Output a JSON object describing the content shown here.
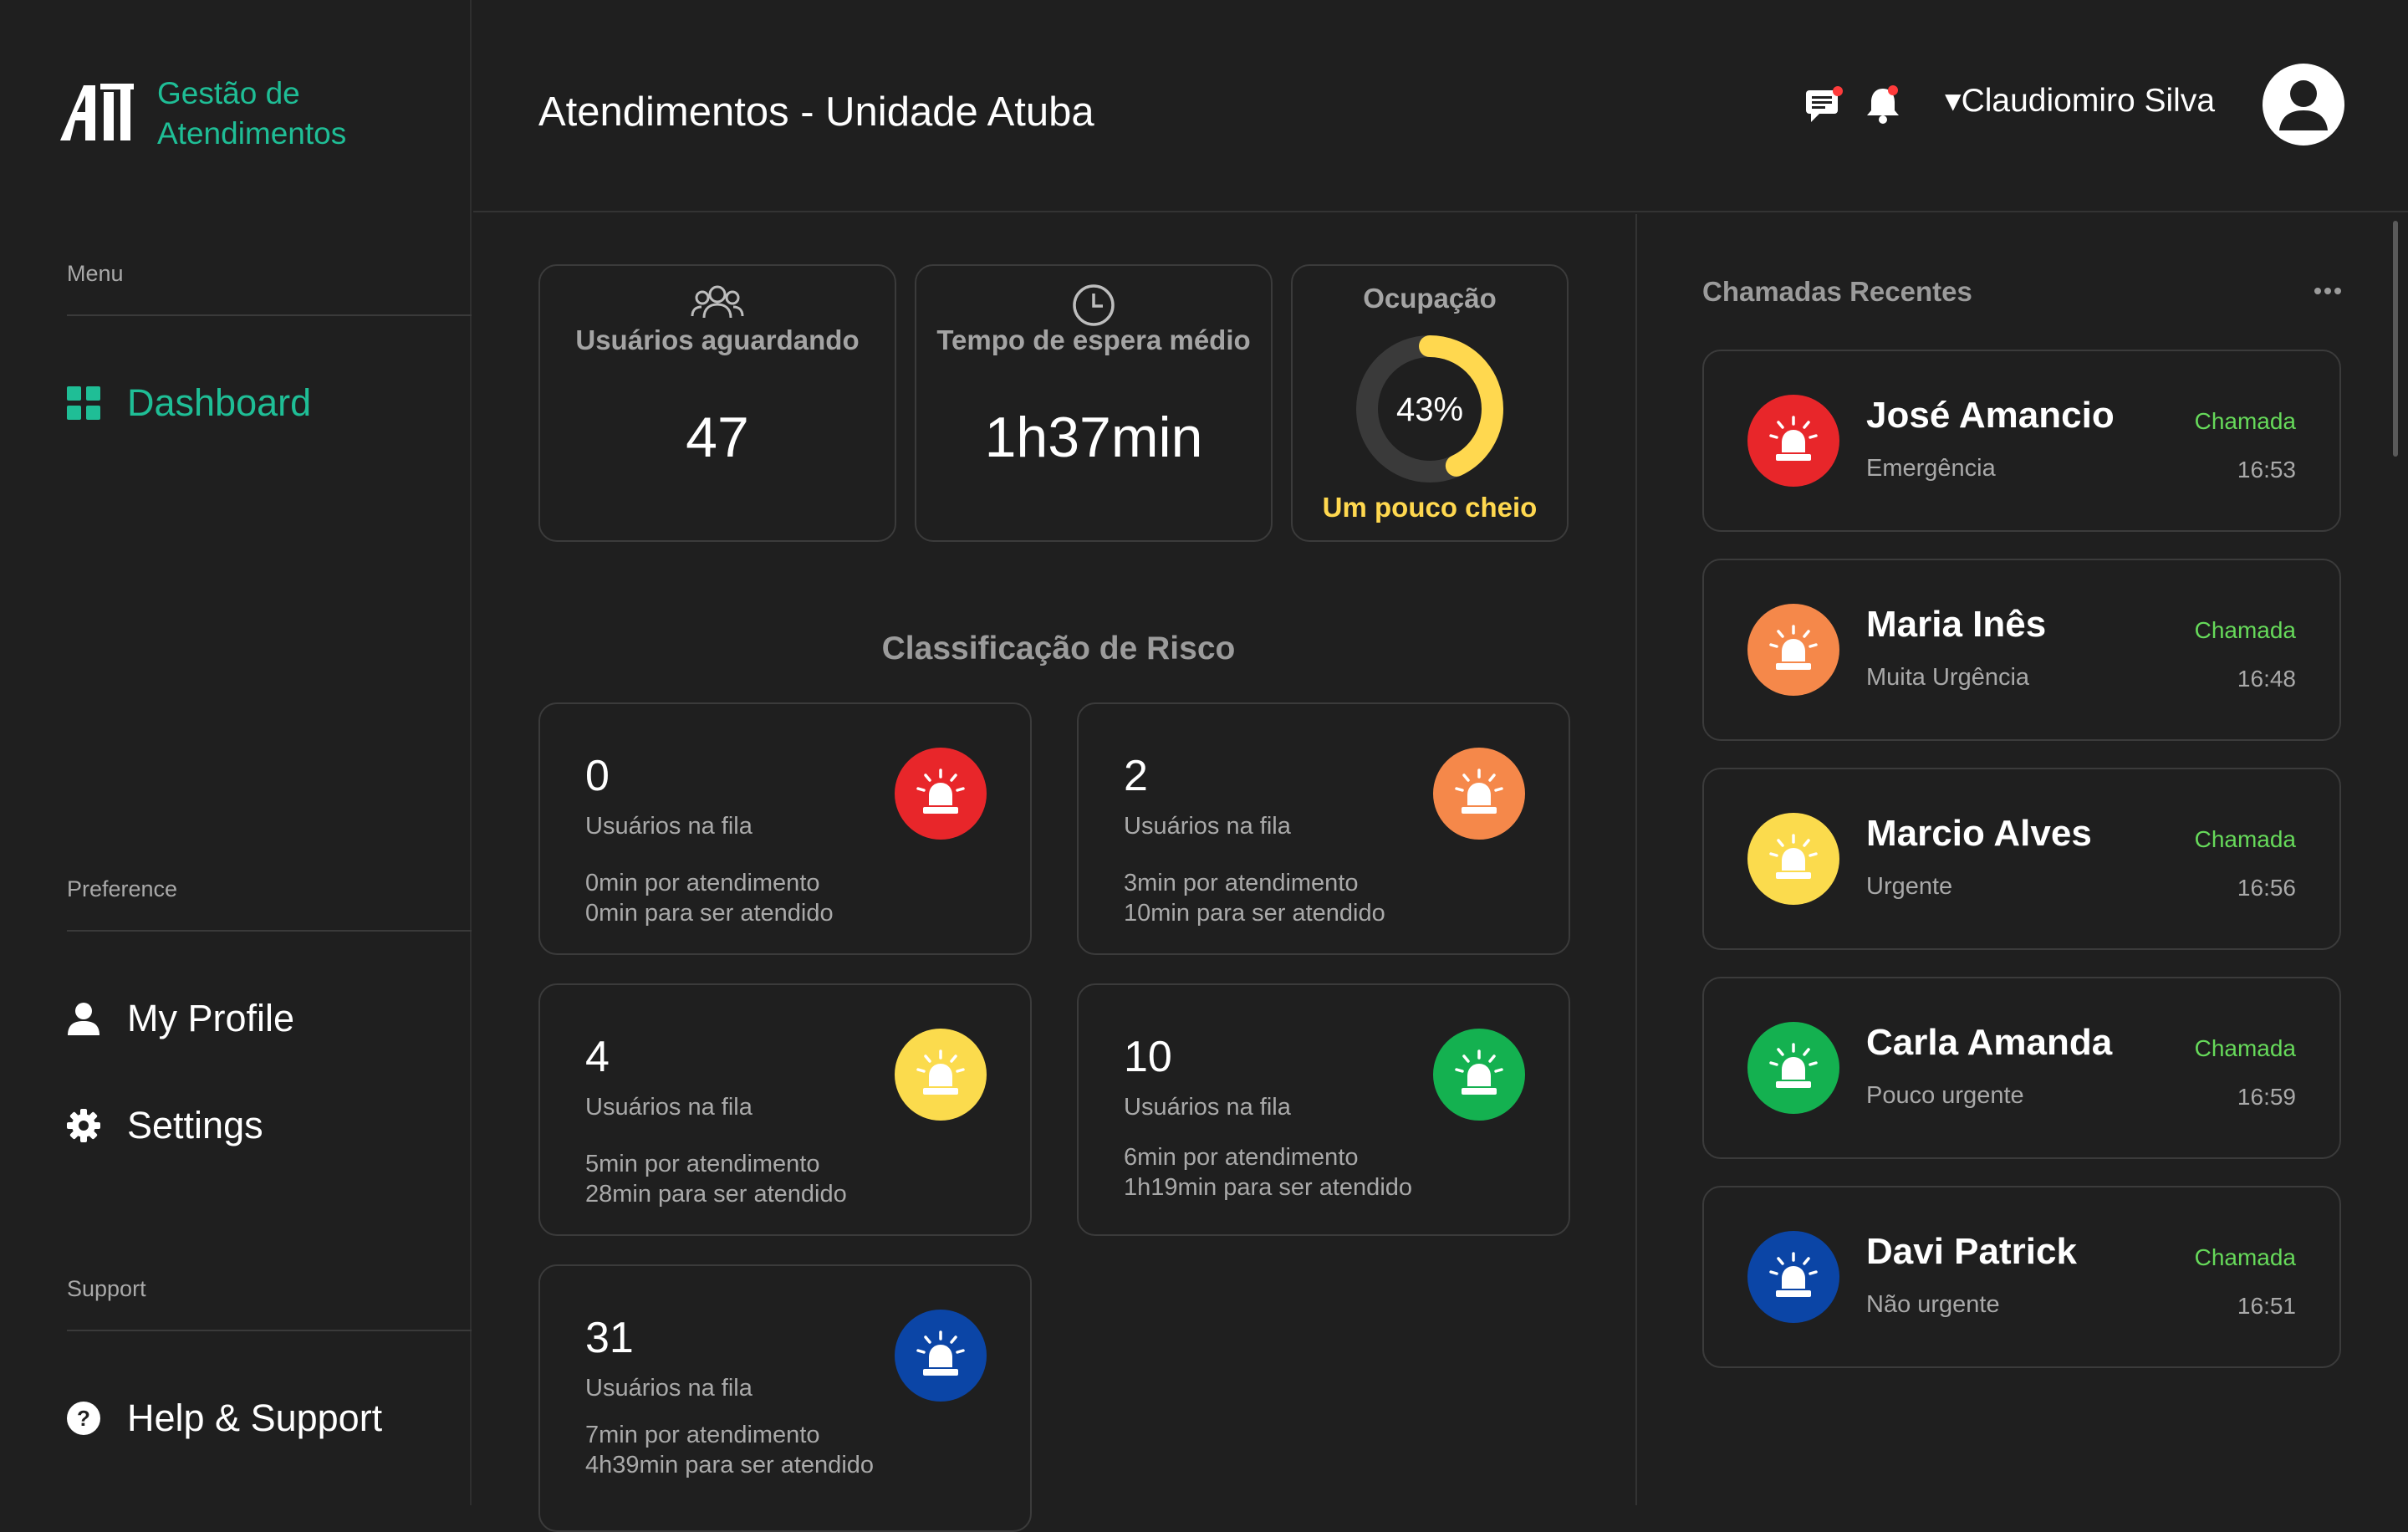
{
  "app": {
    "name": "Gestão de Atendimentos"
  },
  "sidebar": {
    "menu_label": "Menu",
    "items": [
      {
        "label": "Dashboard",
        "icon": "grid-icon",
        "active": true
      }
    ],
    "preference_label": "Preference",
    "preference_items": [
      {
        "label": "My Profile",
        "icon": "user-icon"
      },
      {
        "label": "Settings",
        "icon": "gear-icon"
      }
    ],
    "support_label": "Support",
    "support_items": [
      {
        "label": "Help & Support",
        "icon": "help-icon"
      }
    ]
  },
  "header": {
    "title": "Atendimentos - Unidade Atuba",
    "user_name": "▾Claudiomiro Silva",
    "icons": [
      "chat-icon",
      "bell-icon",
      "avatar-icon"
    ]
  },
  "stats": {
    "waiting": {
      "title": "Usuários aguardando",
      "value": "47",
      "icon": "users-icon"
    },
    "wait_time": {
      "title": "Tempo de espera médio",
      "value": "1h37min",
      "icon": "clock-icon"
    },
    "occupancy": {
      "title": "Ocupação",
      "percent": 43,
      "percent_label": "43%",
      "status": "Um pouco cheio"
    }
  },
  "risk": {
    "title": "Classificação de Risco",
    "cards": [
      {
        "count": "0",
        "label": "Usuários na fila",
        "line1": "0min por atendimento",
        "line2": "0min para ser atendido",
        "color": "#e8262a"
      },
      {
        "count": "2",
        "label": "Usuários na fila",
        "line1": "3min por atendimento",
        "line2": "10min para ser atendido",
        "color": "#f5884a"
      },
      {
        "count": "4",
        "label": "Usuários na fila",
        "line1": "5min por atendimento",
        "line2": "28min para ser atendido",
        "color": "#fbdb4d"
      },
      {
        "count": "10",
        "label": "Usuários na fila",
        "line1": "6min por atendimento",
        "line2": "1h19min para ser atendido",
        "color": "#14b150"
      },
      {
        "count": "31",
        "label": "Usuários na fila",
        "line1": "7min por atendimento",
        "line2": "4h39min para ser atendido",
        "color": "#0b45a6"
      }
    ]
  },
  "recent": {
    "title": "Chamadas Recentes",
    "calls": [
      {
        "name": "José Amancio",
        "category": "Emergência",
        "status": "Chamada",
        "time": "16:53",
        "color": "#e8262a"
      },
      {
        "name": "Maria Inês",
        "category": "Muita Urgência",
        "status": "Chamada",
        "time": "16:48",
        "color": "#f5884a"
      },
      {
        "name": "Marcio Alves",
        "category": "Urgente",
        "status": "Chamada",
        "time": "16:56",
        "color": "#fbdb4d"
      },
      {
        "name": "Carla Amanda",
        "category": "Pouco urgente",
        "status": "Chamada",
        "time": "16:59",
        "color": "#14b150"
      },
      {
        "name": "Davi Patrick",
        "category": "Não urgente",
        "status": "Chamada",
        "time": "16:51",
        "color": "#0b45a6"
      }
    ]
  },
  "colors": {
    "accent": "#1fbe96",
    "warning": "#ffd84f",
    "status_green": "#66d95a"
  }
}
